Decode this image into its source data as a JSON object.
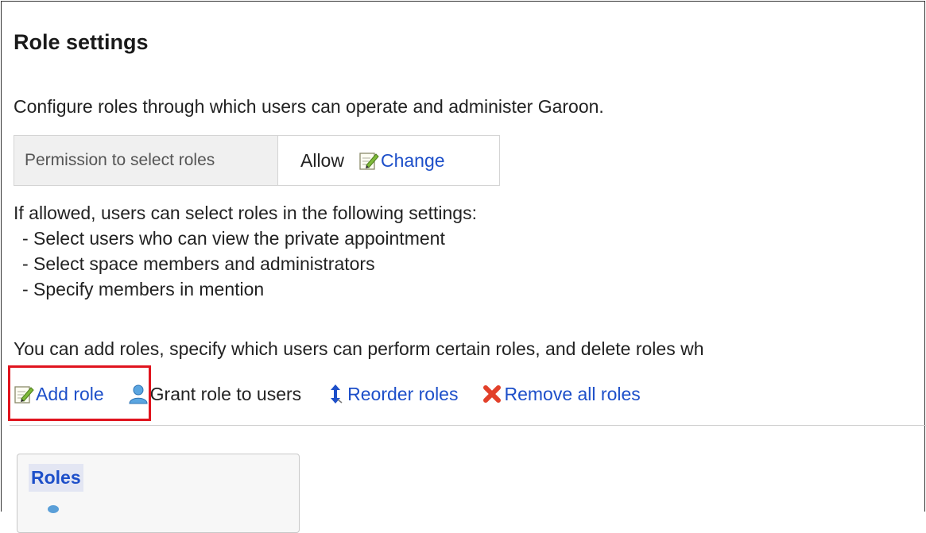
{
  "page": {
    "title": "Role settings",
    "description": "Configure roles through which users can operate and administer Garoon."
  },
  "permission": {
    "label": "Permission to select roles",
    "value": "Allow",
    "change_link": "Change"
  },
  "info": {
    "intro": "If allowed, users can select roles in the following settings:",
    "items": [
      "- Select users who can view the private appointment",
      "- Select space members and administrators",
      "- Specify members in mention"
    ]
  },
  "add_description": "You can add roles, specify which users can perform certain roles, and delete roles wh",
  "actions": {
    "add_role": "Add role",
    "grant_role": "Grant role to users",
    "reorder_roles": "Reorder roles",
    "remove_all": "Remove all roles"
  },
  "roles_panel": {
    "header": "Roles"
  },
  "colors": {
    "link": "#1d4fc9",
    "highlight": "#e0141e"
  },
  "icons": {
    "change": "edit-icon",
    "add_role": "edit-icon",
    "grant_role": "user-icon",
    "reorder_roles": "updown-arrow-icon",
    "remove_all": "red-x-icon"
  }
}
